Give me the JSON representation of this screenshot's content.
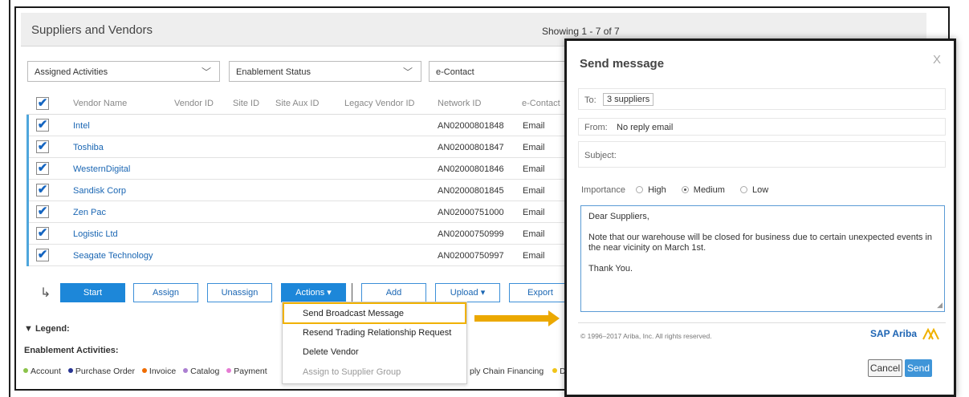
{
  "header": {
    "title": "Suppliers and Vendors",
    "showing": "Showing 1 - 7 of 7"
  },
  "filters": [
    {
      "label": "Assigned Activities"
    },
    {
      "label": "Enablement Status"
    },
    {
      "label": "e-Contact"
    }
  ],
  "table": {
    "columns": [
      "Vendor Name",
      "Vendor ID",
      "Site ID",
      "Site Aux ID",
      "Legacy Vendor ID",
      "Network ID",
      "e-Contact"
    ],
    "rows": [
      {
        "name": "Intel",
        "network_id": "AN02000801848",
        "econtact": "Email"
      },
      {
        "name": "Toshiba",
        "network_id": "AN02000801847",
        "econtact": "Email"
      },
      {
        "name": "WesternDigital",
        "network_id": "AN02000801846",
        "econtact": "Email"
      },
      {
        "name": "Sandisk Corp",
        "network_id": "AN02000801845",
        "econtact": "Email"
      },
      {
        "name": "Zen Pac",
        "network_id": "AN02000751000",
        "econtact": "Email"
      },
      {
        "name": "Logistic Ltd",
        "network_id": "AN02000750999",
        "econtact": "Email"
      },
      {
        "name": "Seagate Technology",
        "network_id": "AN02000750997",
        "econtact": "Email"
      }
    ]
  },
  "toolbar": {
    "start": "Start",
    "assign": "Assign",
    "unassign": "Unassign",
    "actions": "Actions ▾",
    "add": "Add",
    "upload": "Upload ▾",
    "export": "Export"
  },
  "actions_menu": [
    {
      "label": "Send Broadcast Message",
      "enabled": true
    },
    {
      "label": "Resend Trading Relationship Request",
      "enabled": true
    },
    {
      "label": "Delete Vendor",
      "enabled": true
    },
    {
      "label": "Assign to Supplier Group",
      "enabled": false
    }
  ],
  "legend": {
    "title": "▼ Legend:",
    "enablement_title": "Enablement Activities:",
    "items": [
      {
        "label": "Account",
        "color": "#8bc34a"
      },
      {
        "label": "Purchase Order",
        "color": "#283593"
      },
      {
        "label": "Invoice",
        "color": "#ef6c00"
      },
      {
        "label": "Catalog",
        "color": "#ab7fd1"
      },
      {
        "label": "Payment",
        "color": "#e57bd3"
      }
    ],
    "tail_label": "ply Chain Financing",
    "tail_dot_color": "#f0c419",
    "tail_cut": "D"
  },
  "modal": {
    "title": "Send message",
    "close": "X",
    "to_label": "To:",
    "to_value": "3 suppliers",
    "from_label": "From:",
    "from_value": "No reply email",
    "subject_label": "Subject:",
    "importance_label": "Importance",
    "importance_options": [
      "High",
      "Medium",
      "Low"
    ],
    "importance_selected": "Medium",
    "body": {
      "greeting": "Dear Suppliers,",
      "paragraph": "Note that our warehouse will be closed for business due to certain unexpected events in the near vicinity on March 1st.",
      "closing": "Thank You."
    },
    "copyright": "© 1996–2017 Ariba, Inc. All rights reserved.",
    "logo": "SAP Ariba",
    "cancel": "Cancel",
    "send": "Send"
  },
  "colors": {
    "primary": "#1d87d9",
    "link": "#1a66b3",
    "highlight": "#f0b100",
    "row_bar": "#4ea6dc"
  }
}
